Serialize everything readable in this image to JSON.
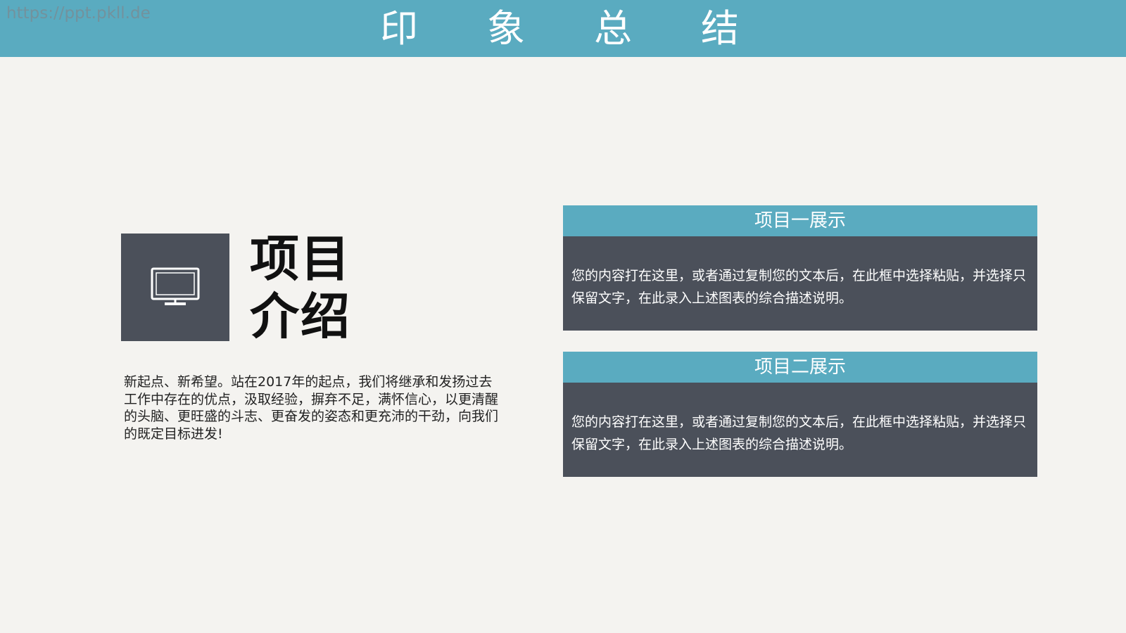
{
  "watermark": "https://ppt.pkll.de",
  "header": {
    "title_chars": [
      "印",
      "象",
      "总",
      "结"
    ]
  },
  "intro": {
    "icon": "monitor-icon",
    "title_line1": "项目",
    "title_line2": "介绍",
    "text": "新起点、新希望。站在2017年的起点，我们将继承和发扬过去工作中存在的优点，汲取经验，摒弃不足，满怀信心，以更清醒的头脑、更旺盛的斗志、更奋发的姿态和更充沛的干劲，向我们的既定目标进发!"
  },
  "cards": [
    {
      "title": "项目一展示",
      "body": "您的内容打在这里，或者通过复制您的文本后，在此框中选择粘贴，并选择只保留文字，在此录入上述图表的综合描述说明。"
    },
    {
      "title": "项目二展示",
      "body": "您的内容打在这里，或者通过复制您的文本后，在此框中选择粘贴，并选择只保留文字，在此录入上述图表的综合描述说明。"
    }
  ],
  "colors": {
    "accent": "#5aabc0",
    "dark": "#4b505a",
    "background": "#f4f3f0"
  }
}
